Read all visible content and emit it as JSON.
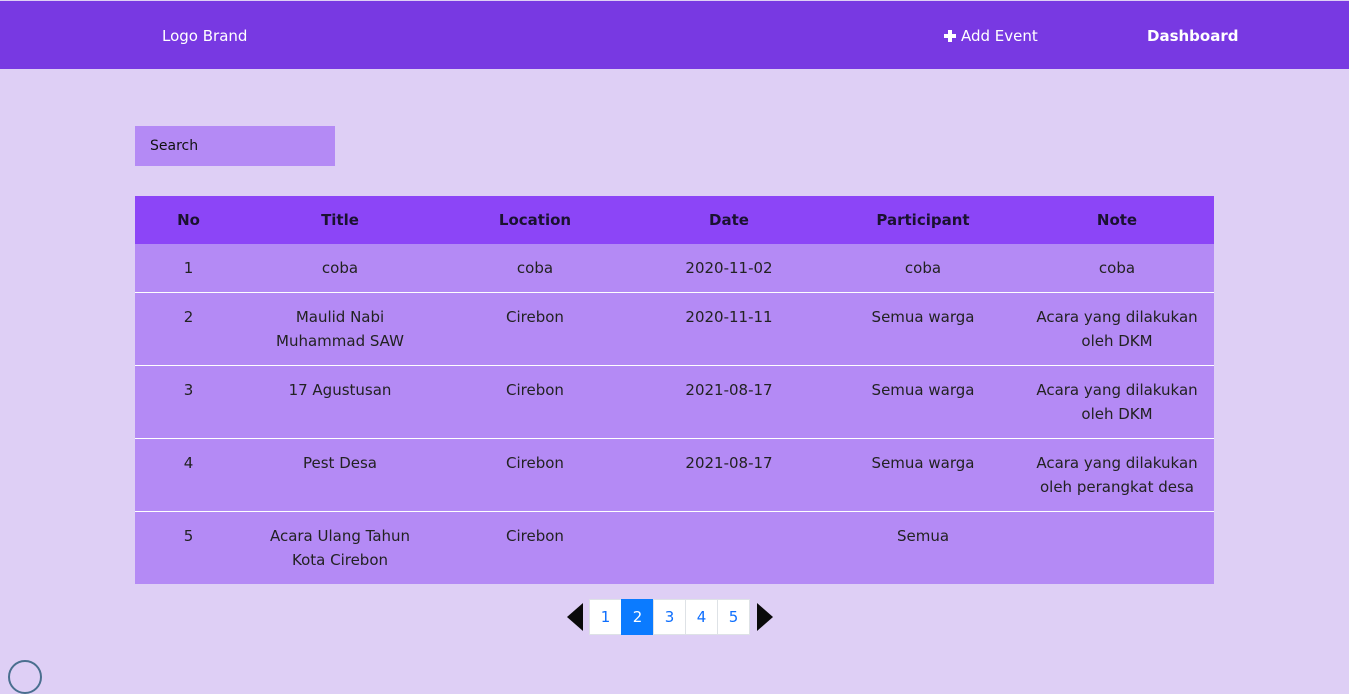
{
  "navbar": {
    "brand": "Logo Brand",
    "add_event": "Add Event",
    "dashboard": "Dashboard"
  },
  "search": {
    "placeholder": "Search"
  },
  "table": {
    "headers": [
      "No",
      "Title",
      "Location",
      "Date",
      "Participant",
      "Note"
    ],
    "rows": [
      [
        "1",
        "coba",
        "coba",
        "2020-11-02",
        "coba",
        "coba"
      ],
      [
        "2",
        "Maulid Nabi Muhammad SAW",
        "Cirebon",
        "2020-11-11",
        "Semua warga",
        "Acara yang dilakukan oleh DKM"
      ],
      [
        "3",
        "17 Agustusan",
        "Cirebon",
        "2021-08-17",
        "Semua warga",
        "Acara yang dilakukan oleh DKM"
      ],
      [
        "4",
        "Pest Desa",
        "Cirebon",
        "2021-08-17",
        "Semua warga",
        "Acara yang dilakukan oleh perangkat desa"
      ],
      [
        "5",
        "Acara Ulang Tahun Kota Cirebon",
        "Cirebon",
        "",
        "Semua",
        ""
      ]
    ]
  },
  "pagination": {
    "pages": [
      "1",
      "2",
      "3",
      "4",
      "5"
    ],
    "active": "2"
  },
  "colors": {
    "navbar": "#7839e2",
    "background": "#decff5",
    "table_header": "#8c45f7",
    "table_row": "#b48af5",
    "active_page": "#0b7bff"
  }
}
